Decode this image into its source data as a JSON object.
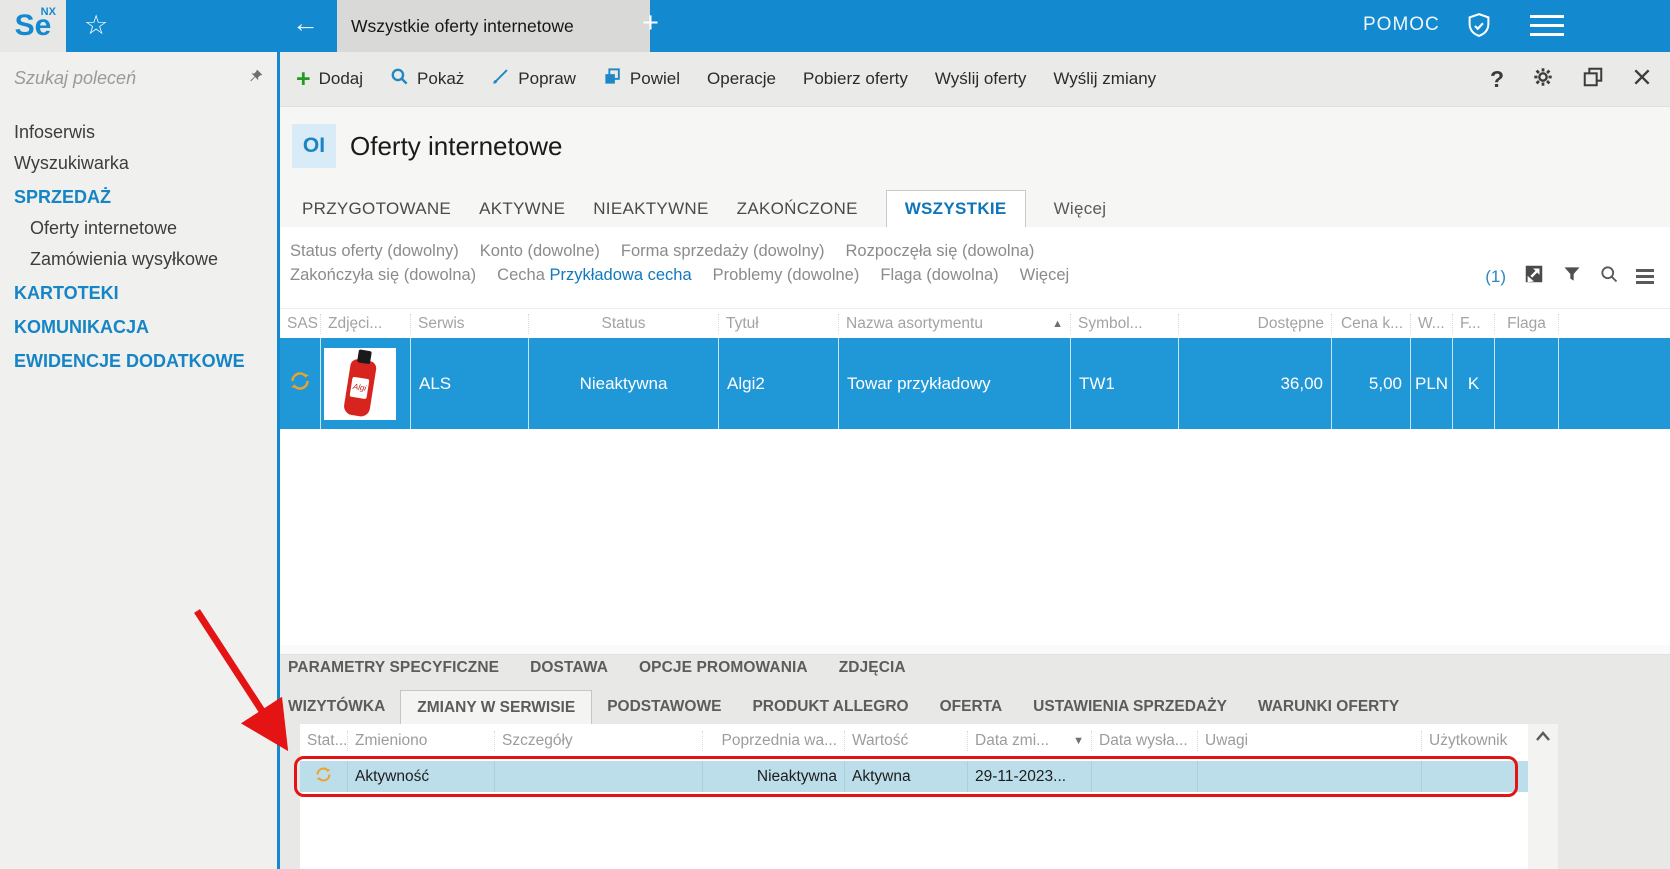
{
  "topbar": {
    "logo": "Se",
    "logo_sup": "NX",
    "document_tab": "Wszystkie oferty internetowe",
    "new_tab": "+",
    "help_label": "POMOC",
    "back_arrow": "←",
    "star": "☆"
  },
  "toolbar": {
    "add": "Dodaj",
    "show": "Pokaż",
    "edit": "Popraw",
    "duplicate": "Powiel",
    "operations": "Operacje",
    "fetch_offers": "Pobierz oferty",
    "send_offers": "Wyślij oferty",
    "send_changes": "Wyślij zmiany",
    "help": "?"
  },
  "sidebar": {
    "search_placeholder": "Szukaj poleceń",
    "items": [
      {
        "label": "Infoserwis",
        "type": "item"
      },
      {
        "label": "Wyszukiwarka",
        "type": "item"
      },
      {
        "label": "SPRZEDAŻ",
        "type": "section"
      },
      {
        "label": "Oferty internetowe",
        "type": "subitem"
      },
      {
        "label": "Zamówienia wysyłkowe",
        "type": "subitem"
      },
      {
        "label": "KARTOTEKI",
        "type": "section"
      },
      {
        "label": "KOMUNIKACJA",
        "type": "section"
      },
      {
        "label": "EWIDENCJE DODATKOWE",
        "type": "section"
      }
    ]
  },
  "page": {
    "badge": "OI",
    "title": "Oferty internetowe"
  },
  "view_tabs": {
    "items": [
      "PRZYGOTOWANE",
      "AKTYWNE",
      "NIEAKTYWNE",
      "ZAKOŃCZONE",
      "WSZYSTKIE"
    ],
    "active": "WSZYSTKIE",
    "more": "Więcej"
  },
  "filters": {
    "status": "Status oferty (dowolny)",
    "konto": "Konto (dowolne)",
    "forma": "Forma sprzedaży (dowolny)",
    "rozpoczela": "Rozpoczęła się (dowolna)",
    "zakonczyla": "Zakończyła się (dowolna)",
    "cecha_label": "Cecha",
    "cecha_value": "Przykładowa cecha",
    "problemy": "Problemy (dowolne)",
    "flaga": "Flaga (dowolna)",
    "more": "Więcej",
    "count": "(1)"
  },
  "offers_grid": {
    "columns": [
      "SAS",
      "Zdjęci...",
      "Serwis",
      "Status",
      "Tytuł",
      "Nazwa asortymentu",
      "Symbol...",
      "Dostępne",
      "Cena k...",
      "W...",
      "F...",
      "Flaga"
    ],
    "sorted_by": "Nazwa asortymentu",
    "sort_direction": "asc",
    "rows": [
      {
        "serwis": "ALS",
        "status": "Nieaktywna",
        "tytul": "Algi2",
        "nazwa_asortymentu": "Towar przykładowy",
        "symbol": "TW1",
        "dostepne": "36,00",
        "cena": "5,00",
        "waluta": "PLN",
        "f": "K",
        "flaga": ""
      }
    ]
  },
  "detail_tabs": {
    "row1": [
      "PARAMETRY SPECYFICZNE",
      "DOSTAWA",
      "OPCJE PROMOWANIA",
      "ZDJĘCIA"
    ],
    "row2": [
      "WIZYTÓWKA",
      "ZMIANY W SERWISIE",
      "PODSTAWOWE",
      "PRODUKT ALLEGRO",
      "OFERTA",
      "USTAWIENIA SPRZEDAŻY",
      "WARUNKI OFERTY"
    ],
    "active": "ZMIANY W SERWISIE"
  },
  "changes_grid": {
    "columns": [
      "Stat...",
      "Zmieniono",
      "Szczegóły",
      "Poprzednia wa...",
      "Wartość",
      "Data zmi...",
      "Data wysła...",
      "Uwagi",
      "Użytkownik"
    ],
    "sorted_by": "Data zmi...",
    "sort_direction": "desc",
    "rows": [
      {
        "zmieniono": "Aktywność",
        "szczegoly": "",
        "poprzednia_wartosc": "Nieaktywna",
        "wartosc": "Aktywna",
        "data_zmiany": "29-11-2023...",
        "data_wyslania": "",
        "uwagi": "",
        "uzytkownik": ""
      }
    ]
  },
  "colors": {
    "accent_blue": "#1389cf",
    "selected_row_blue": "#2097d7",
    "link_blue": "#1278bc",
    "highlight_row_blue": "#bcdeea",
    "annotation_red": "#e41414",
    "sync_orange": "#f0a127"
  },
  "icons": [
    "star-icon",
    "back-arrow-icon",
    "new-tab-icon",
    "shield-check-icon",
    "menu-icon",
    "pin-icon",
    "add-icon",
    "search-icon",
    "edit-brush-icon",
    "duplicate-icon",
    "help-icon",
    "settings-gear-icon",
    "cascade-windows-icon",
    "close-icon",
    "export-icon",
    "filter-funnel-icon",
    "grid-search-icon",
    "grid-menu-icon",
    "sync-icon",
    "sort-asc-icon",
    "sort-desc-icon",
    "scroll-up-icon",
    "product-photo"
  ]
}
